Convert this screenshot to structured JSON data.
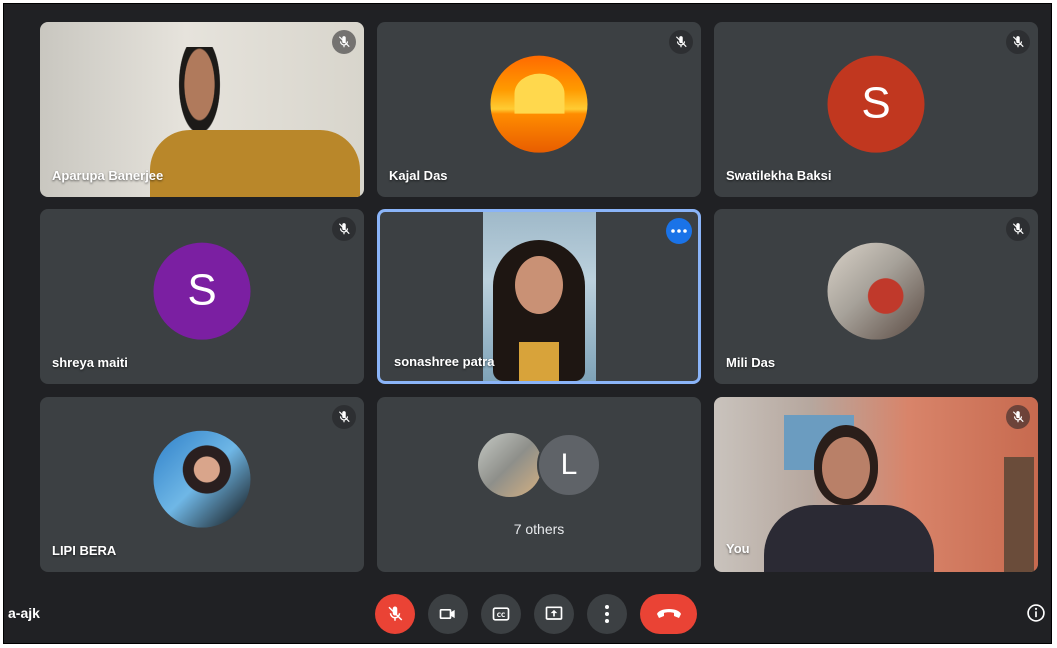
{
  "meeting": {
    "code": "a-ajk"
  },
  "participants": [
    {
      "name": "Aparupa Banerjee",
      "type": "video"
    },
    {
      "name": "Kajal Das",
      "type": "photo",
      "photo": "sunset"
    },
    {
      "name": "Swatilekha Baksi",
      "type": "initial",
      "initial": "S",
      "color": "#c1371f"
    },
    {
      "name": "shreya maiti",
      "type": "initial",
      "initial": "S",
      "color": "#7b1fa2"
    },
    {
      "name": "sonashree patra",
      "type": "video"
    },
    {
      "name": "Mili Das",
      "type": "photo",
      "photo": "portrait"
    },
    {
      "name": "LIPI BERA",
      "type": "photo",
      "photo": "portrait"
    },
    {
      "name": "You",
      "type": "video"
    }
  ],
  "others": {
    "label": "7 others",
    "initial": "L",
    "initial_color": "#5f6368"
  },
  "controls": {
    "mic": "mic-off-icon",
    "camera": "videocam-icon",
    "captions": "closed-captions-icon",
    "present": "present-screen-icon",
    "more": "more-vert-icon",
    "hangup": "call-end-icon",
    "info": "info-icon"
  },
  "colors": {
    "accent": "#8ab4f8",
    "danger": "#ea4335",
    "tile": "#3c4043",
    "background": "#202124"
  }
}
